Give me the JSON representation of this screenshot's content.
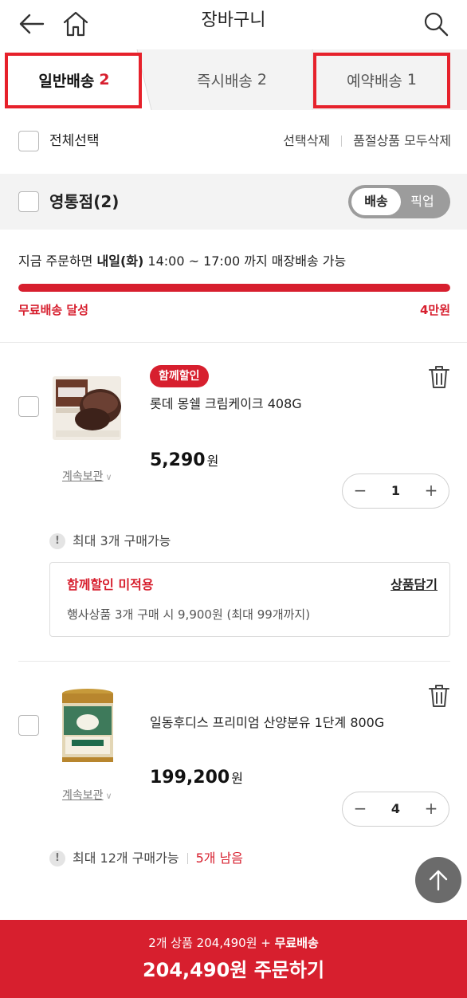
{
  "header": {
    "title": "장바구니"
  },
  "tabs": [
    {
      "label": "일반배송",
      "count": "2"
    },
    {
      "label": "즉시배송",
      "count": "2"
    },
    {
      "label": "예약배송",
      "count": "1"
    }
  ],
  "select_all": {
    "label": "전체선택",
    "delete_selected": "선택삭제",
    "delete_soldout": "품절상품 모두삭제"
  },
  "store": {
    "name": "영통점(2)",
    "toggle_delivery": "배송",
    "toggle_pickup": "픽업"
  },
  "delivery_notice": {
    "prefix": "지금 주문하면 ",
    "day": "내일(화)",
    "time": " 14:00 ~ 17:00",
    "suffix": " 까지 매장배송 가능"
  },
  "free_shipping": {
    "label": "무료배송 달성",
    "threshold": "4만원",
    "progress": 1.0
  },
  "items": [
    {
      "badge": "함께할인",
      "name": "롯데 몽쉘 크림케이크 408G",
      "price": "5,290",
      "currency": "원",
      "keep": "계속보관",
      "qty": "1",
      "limit": "최대 3개 구매가능",
      "remaining": ""
    },
    {
      "badge": "",
      "name": "일동후디스 프리미엄 산양분유 1단계 800G",
      "price": "199,200",
      "currency": "원",
      "keep": "계속보관",
      "qty": "4",
      "limit": "최대 12개 구매가능",
      "remaining": "5개 남음"
    }
  ],
  "promo": {
    "title": "함께할인 미적용",
    "action": "상품담기",
    "desc": "행사상품 3개 구매 시 9,900원 (최대 99개까지)"
  },
  "order": {
    "summary_prefix": "2개 상품 204,490원 + ",
    "summary_free": "무료배송",
    "cta": "204,490원 주문하기"
  },
  "colors": {
    "accent": "#d71f2e",
    "highlight_box": "#e6212b"
  },
  "icons": [
    "back-arrow-icon",
    "home-icon",
    "search-icon",
    "trash-icon",
    "arrow-up-icon",
    "exclamation-icon",
    "chevron-down-icon"
  ]
}
